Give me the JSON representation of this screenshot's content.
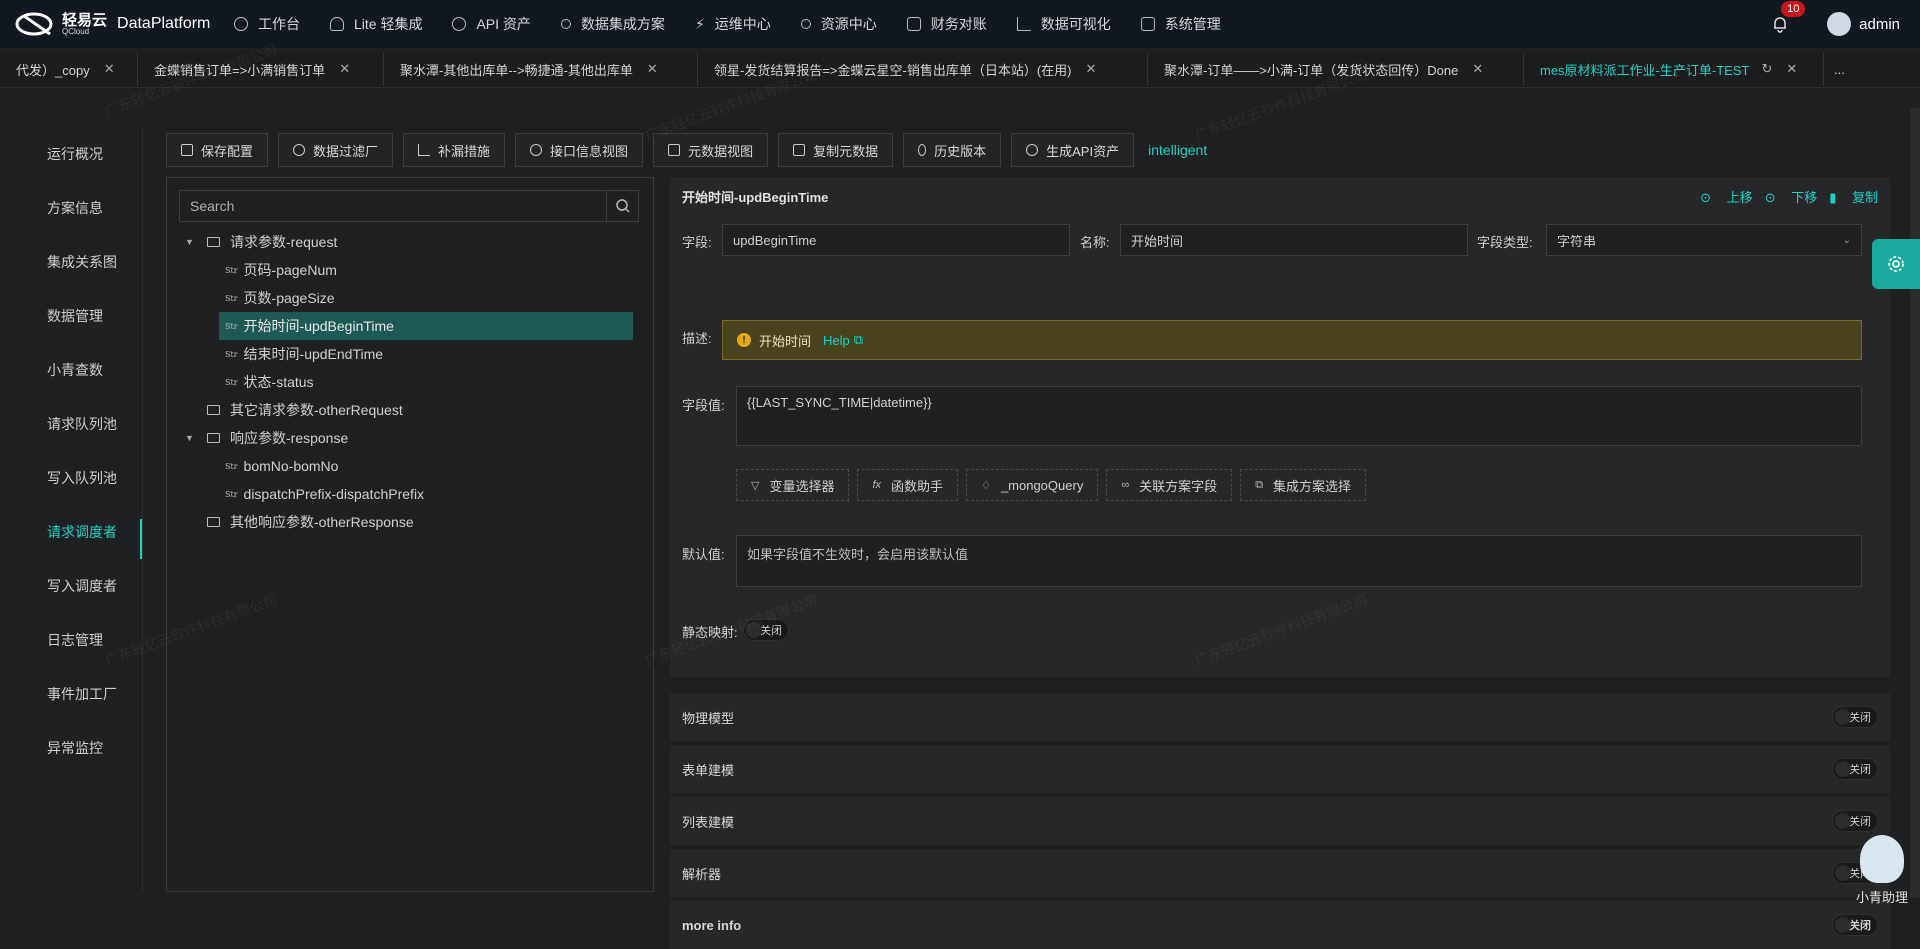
{
  "app": {
    "logo_cn": "轻易云",
    "logo_en": "QCloud",
    "title": "DataPlatform"
  },
  "nav": [
    {
      "label": "工作台",
      "icon": "clock-icon"
    },
    {
      "label": "Lite 轻集成",
      "icon": "bulb-icon"
    },
    {
      "label": "API 资产",
      "icon": "compass-icon"
    },
    {
      "label": "数据集成方案",
      "icon": "share-icon"
    },
    {
      "label": "运维中心",
      "icon": "bolt-icon"
    },
    {
      "label": "资源中心",
      "icon": "tree-icon"
    },
    {
      "label": "财务对账",
      "icon": "calculator-icon"
    },
    {
      "label": "数据可视化",
      "icon": "chart-icon"
    },
    {
      "label": "系统管理",
      "icon": "grid-icon"
    }
  ],
  "user": {
    "notifications": "10",
    "name": "admin"
  },
  "tabs": [
    {
      "label": "代发）_copy"
    },
    {
      "label": "金蝶销售订单=>小满销售订单"
    },
    {
      "label": "聚水潭-其他出库单-->畅捷通-其他出库单"
    },
    {
      "label": "领星-发货结算报告=>金蝶云星空-销售出库单（日本站）(在用)"
    },
    {
      "label": "聚水潭-订单——>小满-订单（发货状态回传）Done"
    },
    {
      "label": "mes原材料派工作业-生产订单-TEST"
    }
  ],
  "tabs_more": "...",
  "leftnav": [
    "运行概况",
    "方案信息",
    "集成关系图",
    "数据管理",
    "小青查数",
    "请求队列池",
    "写入队列池",
    "请求调度者",
    "写入调度者",
    "日志管理",
    "事件加工厂",
    "异常监控"
  ],
  "leftnav_active": "请求调度者",
  "toolbar": {
    "buttons": [
      "保存配置",
      "数据过滤厂",
      "补漏措施",
      "接口信息视图",
      "元数据视图",
      "复制元数据",
      "历史版本",
      "生成API资产"
    ],
    "tag": "intelligent"
  },
  "tree": {
    "search_placeholder": "Search",
    "str_tag": "Str",
    "nodes": [
      {
        "label": "请求参数-request"
      },
      {
        "label": "页码-pageNum"
      },
      {
        "label": "页数-pageSize"
      },
      {
        "label": "开始时间-updBeginTime"
      },
      {
        "label": "结束时间-updEndTime"
      },
      {
        "label": "状态-status"
      },
      {
        "label": "其它请求参数-otherRequest"
      },
      {
        "label": "响应参数-response"
      },
      {
        "label": "bomNo-bomNo"
      },
      {
        "label": "dispatchPrefix-dispatchPrefix"
      },
      {
        "label": "其他响应参数-otherResponse"
      }
    ]
  },
  "detail": {
    "title": "开始时间-updBeginTime",
    "actions": {
      "up": "上移",
      "down": "下移",
      "copy": "复制"
    },
    "field_label": "字段:",
    "field_value": "updBeginTime",
    "name_label": "名称:",
    "name_value": "开始时间",
    "type_label": "字段类型:",
    "type_value": "字符串",
    "desc_label": "描述:",
    "desc_value": "开始时间",
    "help": "Help",
    "value_label": "字段值:",
    "value_value": "{{LAST_SYNC_TIME|datetime}}",
    "helpers": [
      {
        "label": "变量选择器",
        "icon": "filter-icon"
      },
      {
        "label": "函数助手",
        "icon": "fx-icon"
      },
      {
        "label": "_mongoQuery",
        "icon": "bulb-icon"
      },
      {
        "label": "关联方案字段",
        "icon": "link-icon"
      },
      {
        "label": "集成方案选择",
        "icon": "window-icon"
      }
    ],
    "default_label": "默认值:",
    "default_placeholder": "如果字段值不生效时，会启用该默认值",
    "static_label": "静态映射:",
    "off": "关闭"
  },
  "sections": [
    "物理模型",
    "表单建模",
    "列表建模",
    "解析器",
    "more info"
  ],
  "assistant": "小青助理",
  "watermark": "广东轻亿云软件科技有限公司"
}
